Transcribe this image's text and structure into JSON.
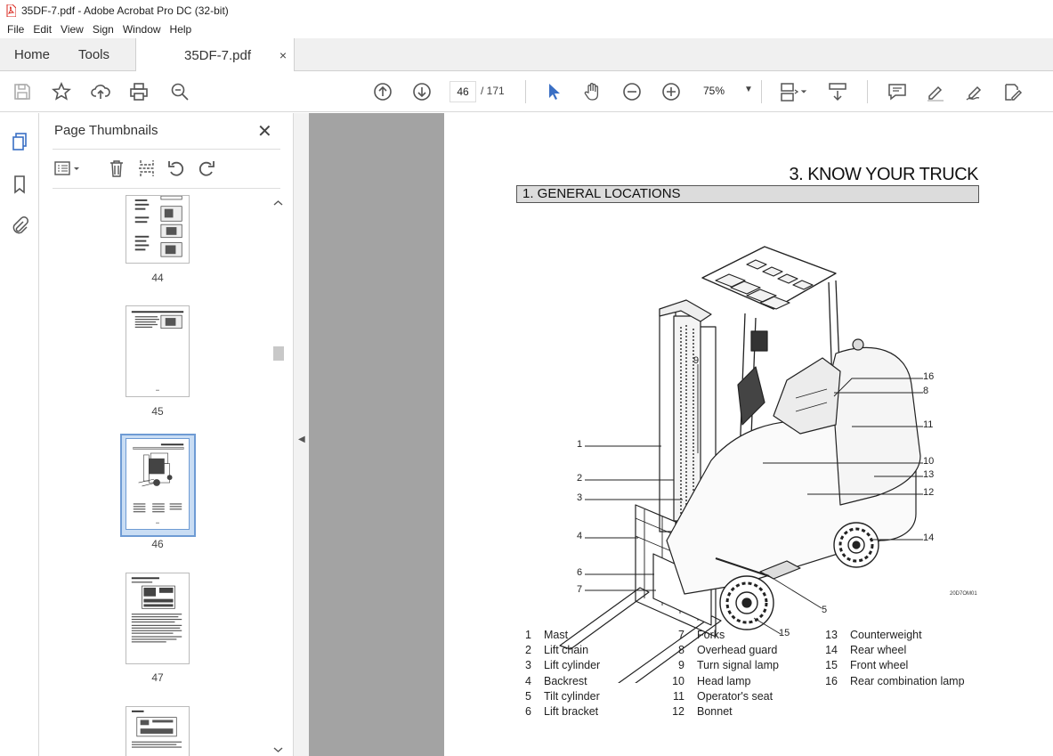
{
  "window": {
    "title": "35DF-7.pdf - Adobe Acrobat Pro DC (32-bit)"
  },
  "menu": [
    "File",
    "Edit",
    "View",
    "Sign",
    "Window",
    "Help"
  ],
  "tabs": {
    "home": "Home",
    "tools": "Tools",
    "doc": "35DF-7.pdf",
    "close": "×"
  },
  "toolbar": {
    "page_current": "46",
    "page_total": "/ 171",
    "zoom": "75%",
    "zoom_options": [
      "75%"
    ]
  },
  "panel": {
    "title": "Page Thumbnails",
    "close": "✕",
    "thumbnails": [
      {
        "page": "44",
        "selected": false
      },
      {
        "page": "45",
        "selected": false
      },
      {
        "page": "46",
        "selected": true
      },
      {
        "page": "47",
        "selected": false
      }
    ]
  },
  "document": {
    "heading": "3. KNOW YOUR TRUCK",
    "section": "1. GENERAL LOCATIONS",
    "figure_code": "20D7OM01",
    "callouts": [
      "1",
      "2",
      "3",
      "4",
      "6",
      "7",
      "9",
      "16",
      "8",
      "11",
      "10",
      "13",
      "12",
      "14",
      "5",
      "15"
    ],
    "legend": [
      [
        {
          "n": "1",
          "label": "Mast"
        },
        {
          "n": "2",
          "label": "Lift chain"
        },
        {
          "n": "3",
          "label": "Lift cylinder"
        },
        {
          "n": "4",
          "label": "Backrest"
        },
        {
          "n": "5",
          "label": "Tilt cylinder"
        },
        {
          "n": "6",
          "label": "Lift bracket"
        }
      ],
      [
        {
          "n": "7",
          "label": "Forks"
        },
        {
          "n": "8",
          "label": "Overhead guard"
        },
        {
          "n": "9",
          "label": "Turn signal lamp"
        },
        {
          "n": "10",
          "label": "Head lamp"
        },
        {
          "n": "11",
          "label": "Operator's seat"
        },
        {
          "n": "12",
          "label": "Bonnet"
        }
      ],
      [
        {
          "n": "13",
          "label": "Counterweight"
        },
        {
          "n": "14",
          "label": "Rear wheel"
        },
        {
          "n": "15",
          "label": "Front wheel"
        },
        {
          "n": "16",
          "label": "Rear combination lamp"
        }
      ]
    ]
  },
  "colors": {
    "accent": "#3a6fc4",
    "tab_bg": "#f0f0f0",
    "viewer_bg": "#a3a3a3",
    "pdf_red": "#d9261c"
  }
}
